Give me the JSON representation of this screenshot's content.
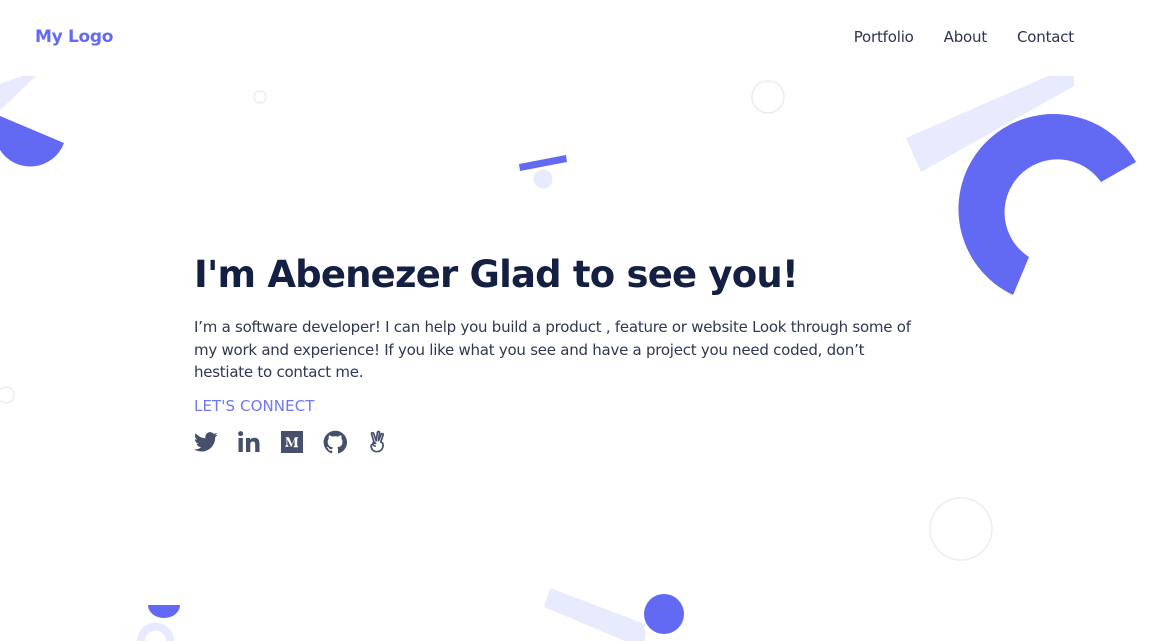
{
  "header": {
    "logo": "My Logo",
    "nav": [
      "Portfolio",
      "About",
      "Contact"
    ]
  },
  "hero": {
    "title": "I'm Abenezer Glad to see you!",
    "description": "I’m a software developer! I can help you build a product , feature or website Look through some of my work and experience! If you like what you see and have a project you need coded, don’t hestiate to contact me.",
    "connect_label": "LET'S CONNECT",
    "socials": [
      "twitter-icon",
      "linkedin-icon",
      "medium-icon",
      "github-icon",
      "angellist-icon"
    ]
  },
  "colors": {
    "accent": "#6269f2",
    "accent_light": "#e8eafd",
    "heading": "#142042",
    "text": "#2f3752"
  }
}
